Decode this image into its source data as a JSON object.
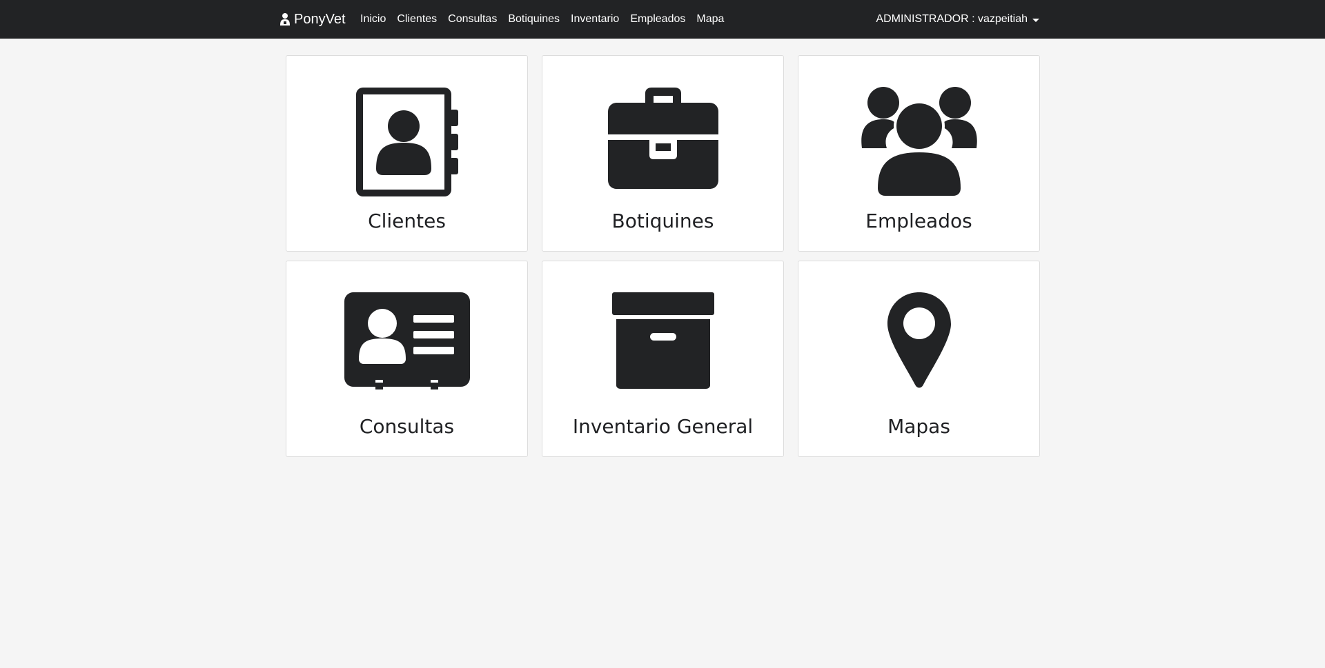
{
  "brand": {
    "name": "PonyVet",
    "icon": "vet-person-icon"
  },
  "nav": {
    "links": [
      "Inicio",
      "Clientes",
      "Consultas",
      "Botiquines",
      "Inventario",
      "Empleados",
      "Mapa"
    ]
  },
  "user_menu": {
    "label": "ADMINISTRADOR : vazpeitiah",
    "icon": "caret-down-icon"
  },
  "cards": [
    {
      "title": "Clientes",
      "icon": "address-book-icon"
    },
    {
      "title": "Botiquines",
      "icon": "briefcase-icon"
    },
    {
      "title": "Empleados",
      "icon": "users-icon"
    },
    {
      "title": "Consultas",
      "icon": "id-card-icon"
    },
    {
      "title": "Inventario General",
      "icon": "archive-box-icon"
    },
    {
      "title": "Mapas",
      "icon": "map-marker-icon"
    }
  ],
  "colors": {
    "navbar_bg": "#222325",
    "page_bg": "#f5f5f5",
    "icon_color": "#222325",
    "card_bg": "#ffffff"
  }
}
